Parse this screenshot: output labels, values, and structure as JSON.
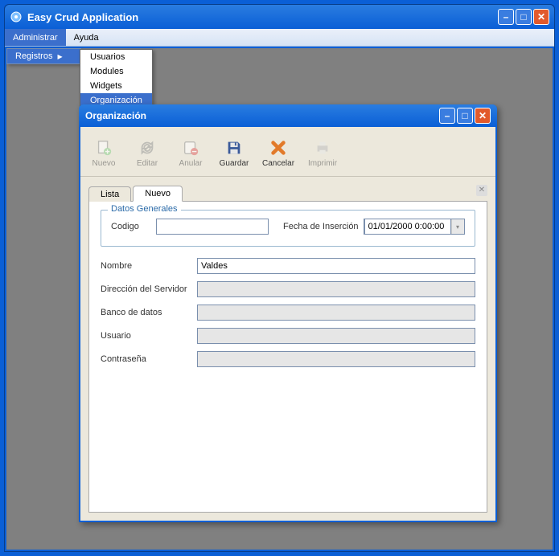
{
  "app": {
    "title": "Easy Crud Application"
  },
  "menubar": {
    "administrar": "Administrar",
    "ayuda": "Ayuda"
  },
  "dropdown": {
    "registros": "Registros"
  },
  "submenu": {
    "usuarios": "Usuarios",
    "modules": "Modules",
    "widgets": "Widgets",
    "organizacion": "Organización"
  },
  "child": {
    "title": "Organización"
  },
  "toolbar": {
    "nuevo": "Nuevo",
    "editar": "Editar",
    "anular": "Anular",
    "guardar": "Guardar",
    "cancelar": "Cancelar",
    "imprimir": "Imprimir"
  },
  "tabs": {
    "lista": "Lista",
    "nuevo": "Nuevo"
  },
  "fieldset": {
    "legend": "Datos Generales",
    "codigo_label": "Codigo",
    "codigo_value": "",
    "fecha_label": "Fecha de Inserción",
    "fecha_value": "01/01/2000 0:00:00"
  },
  "fields": {
    "nombre_label": "Nombre",
    "nombre_value": "Valdes",
    "direccion_label": "Dirección del Servidor",
    "direccion_value": "",
    "banco_label": "Banco de datos",
    "banco_value": "",
    "usuario_label": "Usuario",
    "usuario_value": "",
    "contrasena_label": "Contraseña",
    "contrasena_value": ""
  }
}
